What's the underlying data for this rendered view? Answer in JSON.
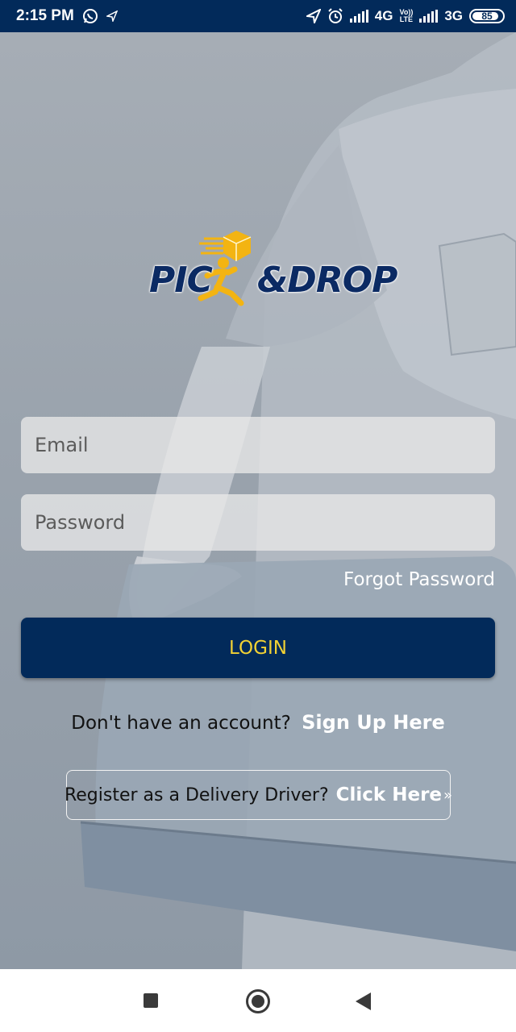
{
  "status_bar": {
    "time": "2:15 PM",
    "network_1": "4G",
    "volte_top": "Vo))",
    "volte_bottom": "LTE",
    "network_2": "3G",
    "battery": "85",
    "icons": [
      "whatsapp-icon",
      "navigation-icon",
      "location-arrow-icon",
      "alarm-icon",
      "signal-icon",
      "battery-icon"
    ]
  },
  "logo": {
    "text_left": "PIC",
    "text_right": "&DROP",
    "colors": {
      "navy": "#0b2a63",
      "yellow": "#f3b412"
    }
  },
  "form": {
    "email_placeholder": "Email",
    "password_placeholder": "Password",
    "forgot_password": "Forgot Password",
    "login_label": "LOGIN"
  },
  "signup": {
    "prompt": "Don't have an account?",
    "link": "Sign Up Here"
  },
  "driver": {
    "prompt": "Register as a Delivery Driver?",
    "link": "Click Here",
    "chevron": "»"
  },
  "nav": {
    "items": [
      "recents-square-icon",
      "home-circle-icon",
      "back-triangle-icon"
    ]
  },
  "colors": {
    "status_bar": "#022a5a",
    "login_button": "#022a5a",
    "login_text": "#f2d234",
    "link_text": "#ffffff"
  }
}
